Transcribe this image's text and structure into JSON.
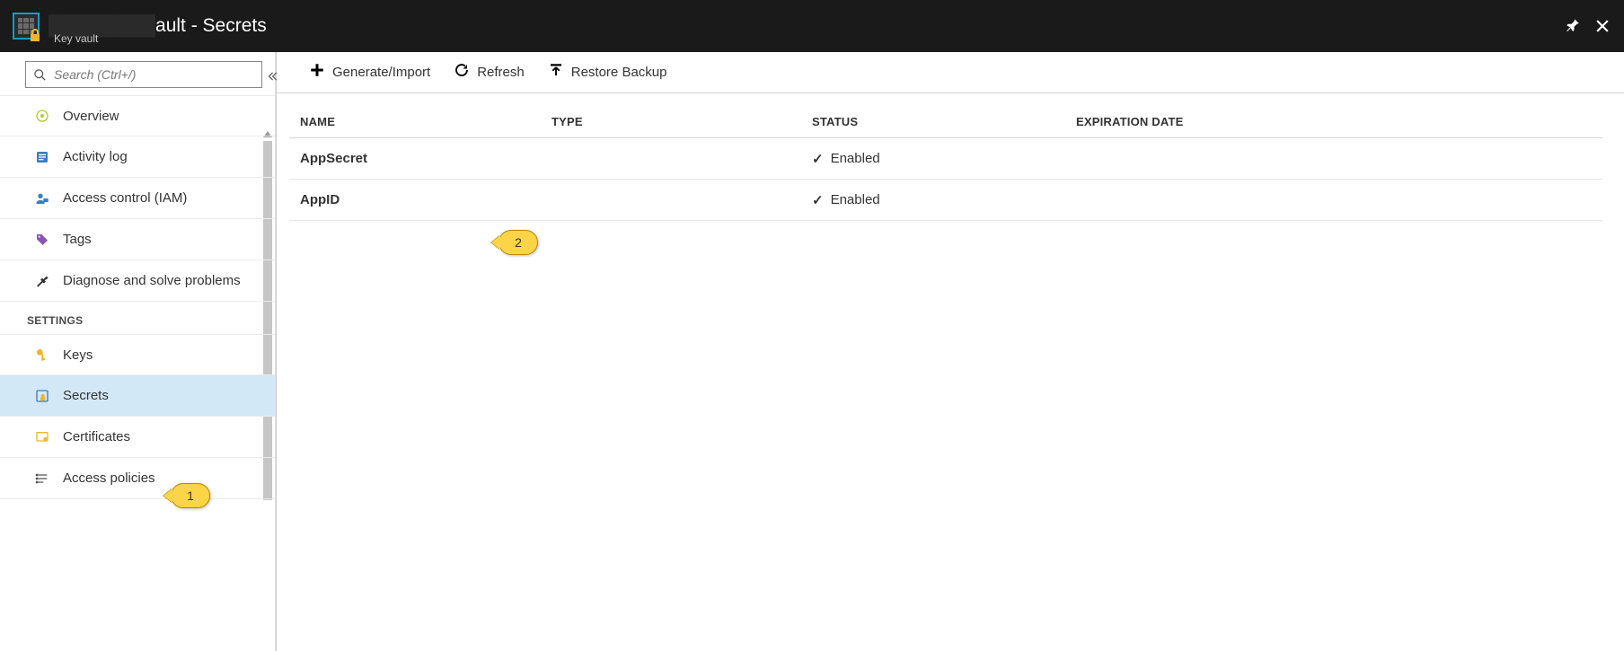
{
  "header": {
    "title_obscured": "████████",
    "title_suffix": "ault - Secrets",
    "subtitle": "Key vault"
  },
  "sidebar": {
    "search_placeholder": "Search (Ctrl+/)",
    "groups": [
      {
        "label": null,
        "items": [
          {
            "id": "overview",
            "label": "Overview",
            "icon": "overview"
          },
          {
            "id": "activity-log",
            "label": "Activity log",
            "icon": "activity"
          },
          {
            "id": "access-control",
            "label": "Access control (IAM)",
            "icon": "iam"
          },
          {
            "id": "tags",
            "label": "Tags",
            "icon": "tag"
          },
          {
            "id": "diagnose",
            "label": "Diagnose and solve problems",
            "icon": "diagnose"
          }
        ]
      },
      {
        "label": "SETTINGS",
        "items": [
          {
            "id": "keys",
            "label": "Keys",
            "icon": "key"
          },
          {
            "id": "secrets",
            "label": "Secrets",
            "icon": "secret",
            "selected": true
          },
          {
            "id": "certificates",
            "label": "Certificates",
            "icon": "certificate"
          },
          {
            "id": "access-policies",
            "label": "Access policies",
            "icon": "policies"
          }
        ]
      }
    ]
  },
  "toolbar": {
    "generate": "Generate/Import",
    "refresh": "Refresh",
    "restore": "Restore Backup"
  },
  "table": {
    "columns": {
      "name": "NAME",
      "type": "TYPE",
      "status": "STATUS",
      "expiration": "EXPIRATION DATE"
    },
    "rows": [
      {
        "name": "AppSecret",
        "type": "",
        "status": "Enabled",
        "expiration": ""
      },
      {
        "name": "AppID",
        "type": "",
        "status": "Enabled",
        "expiration": ""
      }
    ]
  },
  "callouts": {
    "c1": "1",
    "c2": "2"
  }
}
